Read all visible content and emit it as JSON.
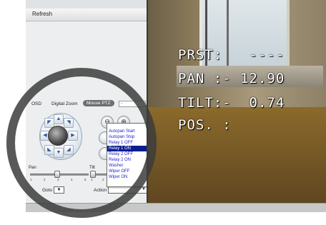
{
  "toolbar": {
    "refresh_label": "Refresh"
  },
  "tabs": [
    {
      "label": "OSD"
    },
    {
      "label": "Digital Zoom"
    },
    {
      "label": "Mouse PTZ"
    }
  ],
  "tab_select": {
    "value": "-"
  },
  "ptz": {
    "arrows": [
      "up-left",
      "up",
      "up-right",
      "left",
      "right",
      "down-left",
      "down",
      "down-right"
    ],
    "arrow_glyphs": {
      "up": "▲",
      "down": "▼",
      "left": "◀",
      "right": "▶",
      "up-left": "◤",
      "up-right": "◥",
      "down-left": "◣",
      "down-right": "◢"
    }
  },
  "zoom": {
    "out_glyph": "⊖",
    "in_glyph": "⊕"
  },
  "pan": {
    "label": "Pan",
    "ticks": [
      "1",
      "2",
      "3",
      "4",
      "5"
    ],
    "level": 0.45
  },
  "tilt": {
    "label": "Tilt",
    "ticks": [
      "1",
      "2"
    ],
    "level": 0.1
  },
  "goto": {
    "label": "Goto",
    "value": "▼"
  },
  "action": {
    "label": "Action",
    "options": [
      "Autopan Start",
      "Autopan Stop",
      "Relay 1 OFF",
      "Relay 1 ON",
      "Relay 2 OFF",
      "Relay 2 ON",
      "Washer",
      "Wiper OFF",
      "Wiper ON"
    ],
    "selected": "Relay 1 ON"
  },
  "osd": {
    "line1": "PRST:   ----",
    "line2": "PAN :- 12.90",
    "line3": "TILT:-  0.74",
    "line4": "POS. :"
  },
  "colors": {
    "selected_bg": "#0a1d8f",
    "option_text": "#1f1fcc",
    "overlay_circle": "#3c3c3c"
  }
}
